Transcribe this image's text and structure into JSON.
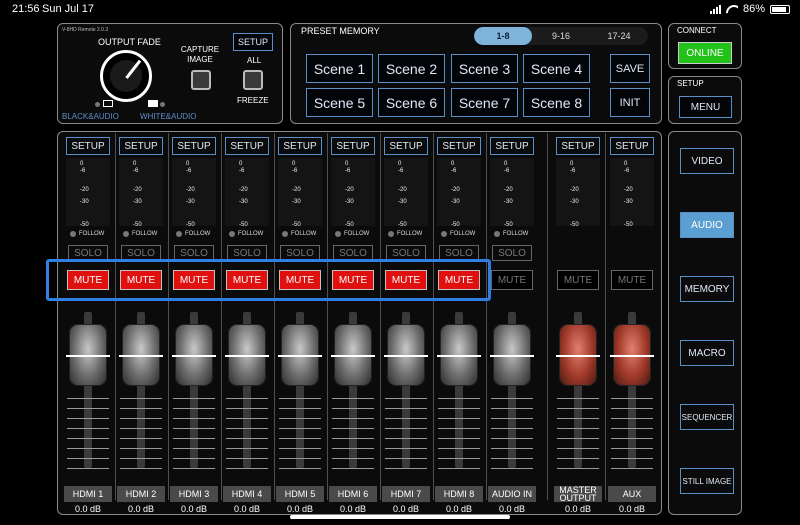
{
  "status": {
    "time": "21:56",
    "date": "Sun Jul 17",
    "battery": "86%"
  },
  "fade": {
    "remote_version": "V-8HD Remote 2.0.3",
    "title": "OUTPUT FADE",
    "left_label": "BLACK&AUDIO",
    "right_label": "WHITE&AUDIO",
    "capture_label": "CAPTURE\nIMAGE",
    "setup_label": "SETUP",
    "all_label": "ALL",
    "freeze_label": "FREEZE"
  },
  "preset": {
    "title": "PRESET MEMORY",
    "tabs": [
      "1-8",
      "9-16",
      "17-24"
    ],
    "scenes": [
      "Scene 1",
      "Scene 2",
      "Scene 3",
      "Scene 4",
      "Scene 5",
      "Scene 6",
      "Scene 7",
      "Scene 8"
    ],
    "save_label": "SAVE",
    "init_label": "INIT"
  },
  "connect": {
    "title": "CONNECT",
    "online_label": "ONLINE"
  },
  "setup_panel": {
    "title": "SETUP",
    "menu_label": "MENU"
  },
  "meter_scale": [
    "0",
    "-6",
    "-20",
    "-30",
    "-50"
  ],
  "follow_label": "FOLLOW",
  "solo_label": "SOLO",
  "mute_label": "MUTE",
  "setup_label": "SETUP",
  "channels": [
    {
      "name": "HDMI 1",
      "db": "0.0 dB"
    },
    {
      "name": "HDMI 2",
      "db": "0.0 dB"
    },
    {
      "name": "HDMI 3",
      "db": "0.0 dB"
    },
    {
      "name": "HDMI 4",
      "db": "0.0 dB"
    },
    {
      "name": "HDMI 5",
      "db": "0.0 dB"
    },
    {
      "name": "HDMI 6",
      "db": "0.0 dB"
    },
    {
      "name": "HDMI 7",
      "db": "0.0 dB"
    },
    {
      "name": "HDMI 8",
      "db": "0.0 dB"
    },
    {
      "name": "AUDIO IN",
      "db": "0.0 dB"
    },
    {
      "name": "MASTER\nOUTPUT",
      "db": "0.0 dB"
    },
    {
      "name": "AUX",
      "db": "0.0 dB"
    }
  ],
  "side_menu": [
    "VIDEO",
    "AUDIO",
    "MEMORY",
    "MACRO",
    "SEQUENCER",
    "STILL IMAGE"
  ],
  "colors": {
    "mute_on": "#e0100f",
    "accent_blue": "#5b9fd2",
    "online_green": "#22c21a",
    "highlight": "#2f7fe7"
  }
}
